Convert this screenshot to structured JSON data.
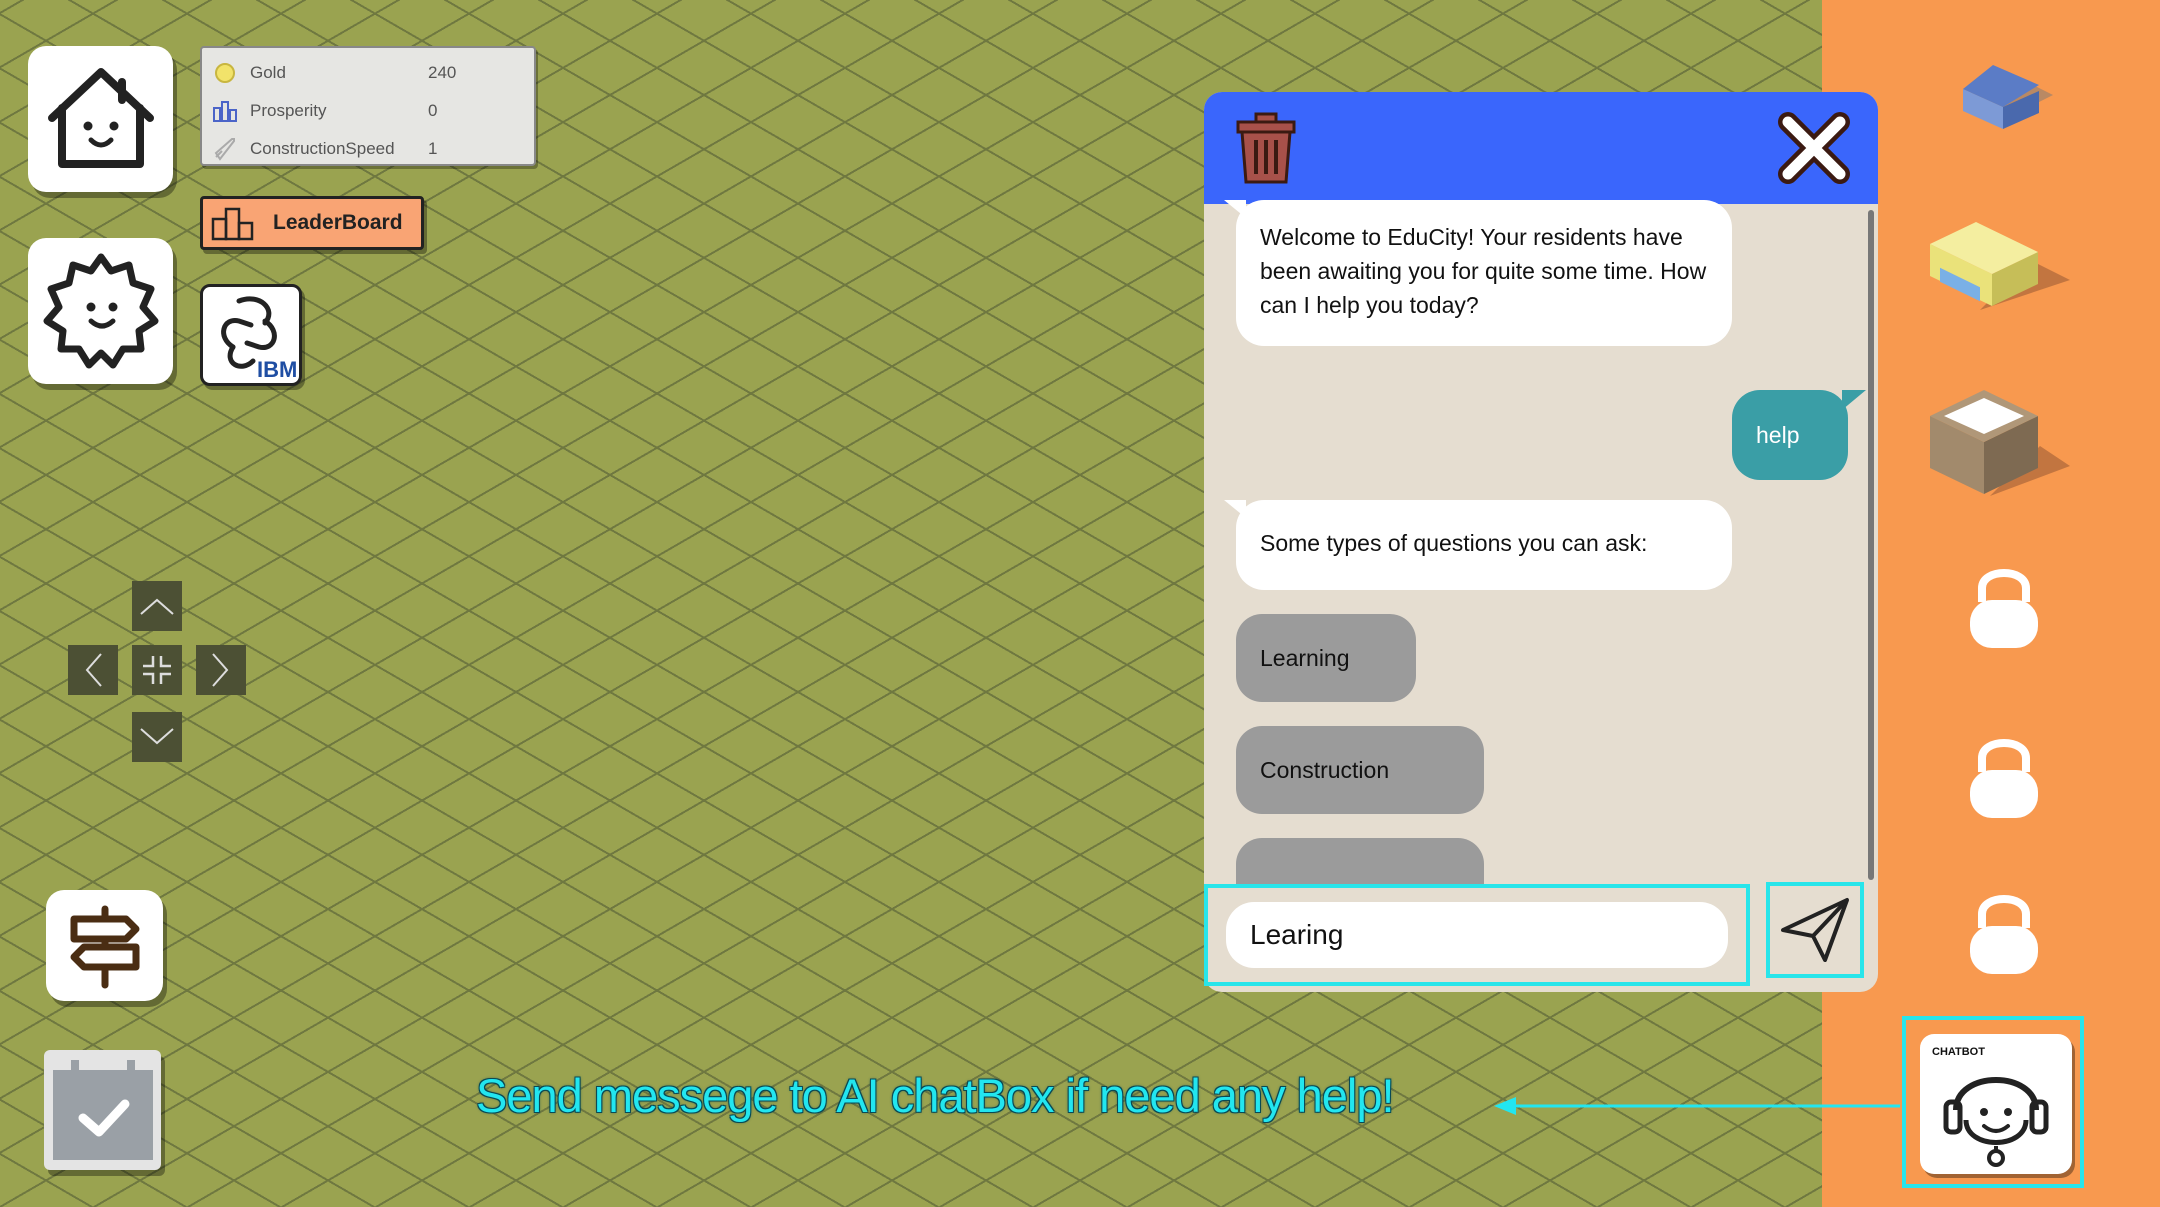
{
  "stats": {
    "gold_label": "Gold",
    "gold_value": "240",
    "prosperity_label": "Prosperity",
    "prosperity_value": "0",
    "speed_label": "ConstructionSpeed",
    "speed_value": "1"
  },
  "leaderboard": {
    "label": "LeaderBoard"
  },
  "ibm": {
    "label": "IBM"
  },
  "chat": {
    "messages": [
      {
        "from": "bot",
        "text": "Welcome to EduCity! Your residents have been awaiting you for quite some time. How can I help you today?"
      },
      {
        "from": "user",
        "text": "help"
      },
      {
        "from": "bot",
        "text": "Some types of questions you can ask:"
      }
    ],
    "options": [
      "Learning",
      "Construction",
      ""
    ],
    "input_value": "Learing"
  },
  "sidebar": {
    "buildings": [
      "house-building-icon",
      "shop-building-icon",
      "box-building-icon"
    ],
    "locked_slots": 3,
    "chatbot_label": "CHATBOT"
  },
  "hint": {
    "text": "Send messege to AI chatBox if need any help!"
  },
  "colors": {
    "grass": "#9aa350",
    "chat_header": "#3a66fc",
    "chat_bg": "#e5ddd0",
    "user_bubble": "#3a9ea6",
    "option_bubble": "#9b9b9b",
    "highlight": "#28e5ea",
    "sidebar": "#f8994f",
    "leaderboard": "#f9a474"
  }
}
